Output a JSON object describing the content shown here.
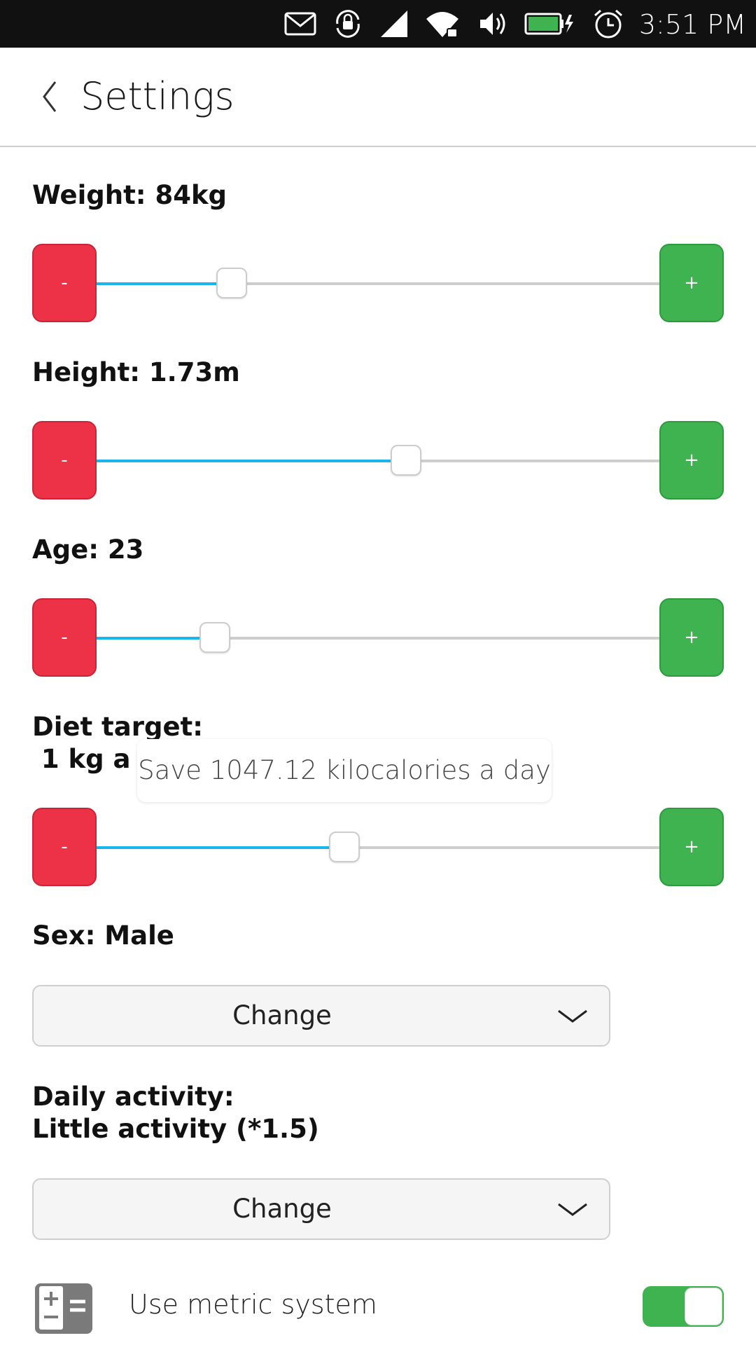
{
  "status_bar": {
    "time": "3:51 PM",
    "icons": [
      "mail-icon",
      "rotation-lock-icon",
      "cell-signal-icon",
      "wifi-icon",
      "volume-icon",
      "battery-charging-icon",
      "alarm-icon"
    ],
    "battery_color": "#3eb34f"
  },
  "header": {
    "title": "Settings",
    "back_icon": "chevron-left-icon"
  },
  "colors": {
    "minus_button": "#ed3146",
    "plus_button": "#3eb34f",
    "slider_fill": "#19b6ee",
    "toggle_on": "#3eb34f"
  },
  "sliders": [
    {
      "id": "weight",
      "label": "Weight: 84kg",
      "minus": "-",
      "plus": "+",
      "level_percent": 24
    },
    {
      "id": "height",
      "label": "Height: 1.73m",
      "minus": "-",
      "plus": "+",
      "level_percent": 55
    },
    {
      "id": "age",
      "label": "Age: 23",
      "minus": "-",
      "plus": "+",
      "level_percent": 21
    },
    {
      "id": "diet",
      "label_line1": "Diet target:",
      "label_line2": " 1 kg a w",
      "minus": "-",
      "plus": "+",
      "level_percent": 44
    }
  ],
  "tooltip": "Save 1047.12 kilocalories a day",
  "sex": {
    "label": "Sex: Male",
    "button": "Change"
  },
  "activity": {
    "label_line1": "Daily activity:",
    "label_line2": "Little activity (*1.5)",
    "button": "Change"
  },
  "metric": {
    "label": "Use metric system",
    "icon": "calculator-icon",
    "enabled": true
  }
}
